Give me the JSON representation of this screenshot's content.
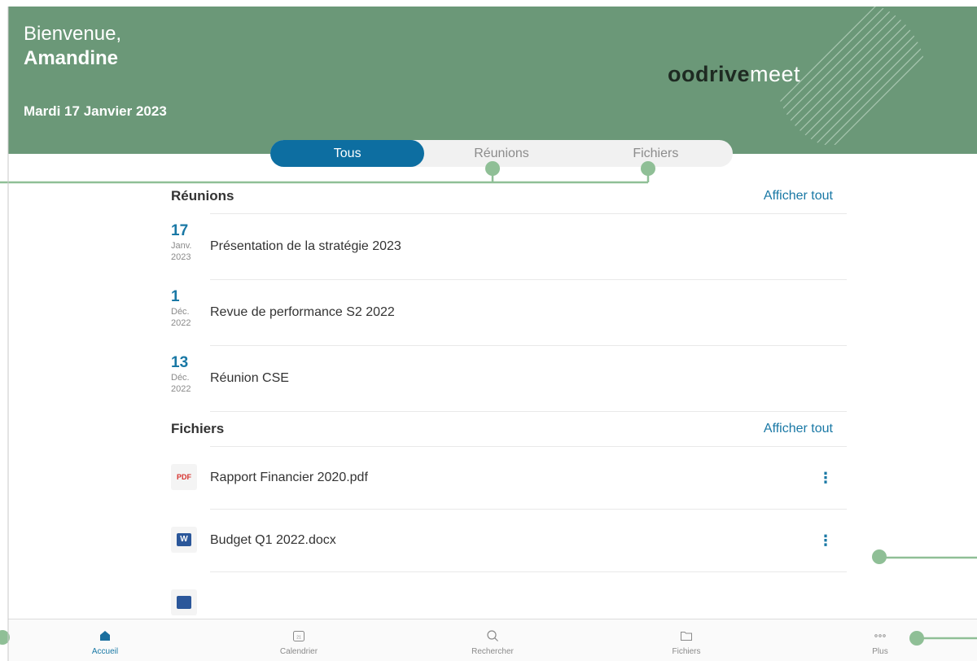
{
  "header": {
    "greeting": "Bienvenue,",
    "user_name": "Amandine",
    "date": "Mardi 17 Janvier 2023",
    "logo_bold": "oodrive",
    "logo_light": "meet"
  },
  "segmented": {
    "tabs": [
      {
        "label": "Tous",
        "active": true
      },
      {
        "label": "Réunions",
        "active": false
      },
      {
        "label": "Fichiers",
        "active": false
      }
    ]
  },
  "meetings": {
    "title": "Réunions",
    "link": "Afficher tout",
    "items": [
      {
        "day": "17",
        "month": "Janv.",
        "year": "2023",
        "title": "Présentation de la stratégie 2023"
      },
      {
        "day": "1",
        "month": "Déc.",
        "year": "2022",
        "title": "Revue de performance  S2 2022"
      },
      {
        "day": "13",
        "month": "Déc.",
        "year": "2022",
        "title": "Réunion CSE"
      }
    ]
  },
  "files": {
    "title": "Fichiers",
    "link": "Afficher tout",
    "items": [
      {
        "type": "pdf",
        "icon_label": "PDF",
        "name": "Rapport Financier 2020.pdf"
      },
      {
        "type": "word",
        "icon_label": "W",
        "name": "Budget Q1 2022.docx"
      }
    ]
  },
  "tabbar": {
    "tabs": [
      {
        "label": "Accueil",
        "icon": "home-icon",
        "active": true
      },
      {
        "label": "Calendrier",
        "icon": "calendar-icon",
        "calendar_day": "21",
        "active": false
      },
      {
        "label": "Rechercher",
        "icon": "search-icon",
        "active": false
      },
      {
        "label": "Fichiers",
        "icon": "folder-icon",
        "active": false
      },
      {
        "label": "Plus",
        "icon": "more-icon",
        "active": false
      }
    ]
  },
  "colors": {
    "header_bg": "#6b9878",
    "accent": "#0d6ea1",
    "link": "#1978a5",
    "callout": "#8fbf96"
  }
}
